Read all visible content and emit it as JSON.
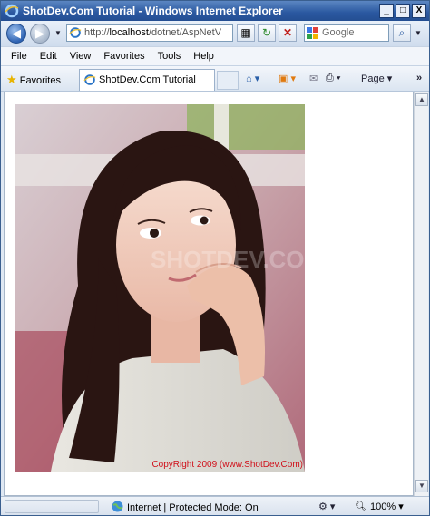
{
  "window": {
    "title": "ShotDev.Com Tutorial - Windows Internet Explorer",
    "buttons": {
      "minimize": "_",
      "maximize": "□",
      "close": "X"
    }
  },
  "addressbar": {
    "url_prefix": "http://",
    "url_host": "localhost",
    "url_path": "/dotnet/AspNetV",
    "search_placeholder": "Google"
  },
  "menu": {
    "items": [
      "File",
      "Edit",
      "View",
      "Favorites",
      "Tools",
      "Help"
    ]
  },
  "favbar": {
    "favorites_label": "Favorites",
    "tab_title": "ShotDev.Com Tutorial",
    "page_label": "Page"
  },
  "content": {
    "image_caption": "CopyRight 2009 (www.ShotDev.Com)",
    "watermark": "SHOTDEV.COM"
  },
  "statusbar": {
    "zone": "Internet | Protected Mode: On",
    "zoom": "100%"
  },
  "colors": {
    "title_bar": "#2a58a0",
    "caption": "#d0101a"
  }
}
